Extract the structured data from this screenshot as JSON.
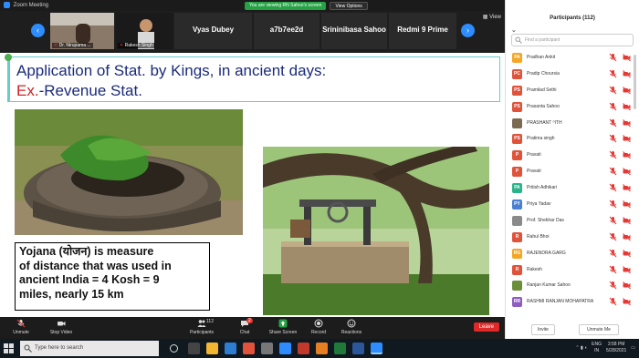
{
  "window": {
    "title": "Zoom Meeting"
  },
  "share": {
    "message": "You are viewing RN Sahoo's screen",
    "view_options": "View Options"
  },
  "gallery": {
    "view_label": "View",
    "tiles": [
      {
        "name": "",
        "mini": "Dr. Nirupama ..."
      },
      {
        "name": "",
        "mini": "Rakesh Singh"
      },
      {
        "name": "Vyas Dubey",
        "mini": ""
      },
      {
        "name": "a7b7ee2d",
        "mini": ""
      },
      {
        "name": "Srininibasa Sahoo",
        "mini": ""
      },
      {
        "name": "Redmi 9 Prime",
        "mini": ""
      }
    ]
  },
  "slide": {
    "title_line1": "Application of Stat. by Kings, in ancient days:",
    "title_ex": "Ex.",
    "title_line2_rest": "-Revenue Stat.",
    "text_lines": [
      "Yojana (योजन)  is measure",
      "of distance that was used in",
      "ancient India = 4 Kosh = 9",
      "miles, nearly 15 km"
    ]
  },
  "toolbar": {
    "items": [
      {
        "label": "Unmute"
      },
      {
        "label": "Stop Video"
      },
      {
        "label": "Participants",
        "count": "112"
      },
      {
        "label": "Chat",
        "badge": "2"
      },
      {
        "label": "Share Screen"
      },
      {
        "label": "Record"
      },
      {
        "label": "Reactions"
      }
    ],
    "leave": "Leave"
  },
  "panel": {
    "title": "Participants (112)",
    "search_placeholder": "Find a participant",
    "invite": "Invite",
    "unmute_me": "Unmute Me",
    "participants": [
      {
        "initials": "PA",
        "name": "Pradhan Ankit",
        "color": "#f5a623"
      },
      {
        "initials": "PC",
        "name": "Pradip Choursia",
        "color": "#e0533a"
      },
      {
        "initials": "PS",
        "name": "Pramilad Sethi",
        "color": "#e0533a"
      },
      {
        "initials": "PS",
        "name": "Prasanta Sahoo",
        "color": "#e0533a"
      },
      {
        "initials": "",
        "name": "PRASHANT ⁰ITH",
        "color": "#7a6a52"
      },
      {
        "initials": "PS",
        "name": "Pratima singh",
        "color": "#e0533a"
      },
      {
        "initials": "P",
        "name": "Pravati",
        "color": "#e0533a"
      },
      {
        "initials": "P",
        "name": "Pravati",
        "color": "#e0533a"
      },
      {
        "initials": "PA",
        "name": "Pritish Adhikari",
        "color": "#2bb38a"
      },
      {
        "initials": "PY",
        "name": "Priya Yadav",
        "color": "#4a7fd4"
      },
      {
        "initials": "",
        "name": "Prof. Shekhar Das",
        "color": "#8a8a8a"
      },
      {
        "initials": "R",
        "name": "Rahul Bhoi",
        "color": "#e0533a"
      },
      {
        "initials": "RG",
        "name": "RAJENDRA GARG",
        "color": "#f5a623"
      },
      {
        "initials": "R",
        "name": "Rakesh",
        "color": "#e0533a"
      },
      {
        "initials": "",
        "name": "Ranjan Kumar Sahoo",
        "color": "#6b8e3a"
      },
      {
        "initials": "RR",
        "name": "RASHMI RANJAN MOHAPATRA",
        "color": "#8e5bbf"
      }
    ]
  },
  "taskbar": {
    "search_placeholder": "Type here to search",
    "lang": "ENG",
    "region": "IN",
    "time": "3:58 PM",
    "date": "5/28/2021"
  }
}
